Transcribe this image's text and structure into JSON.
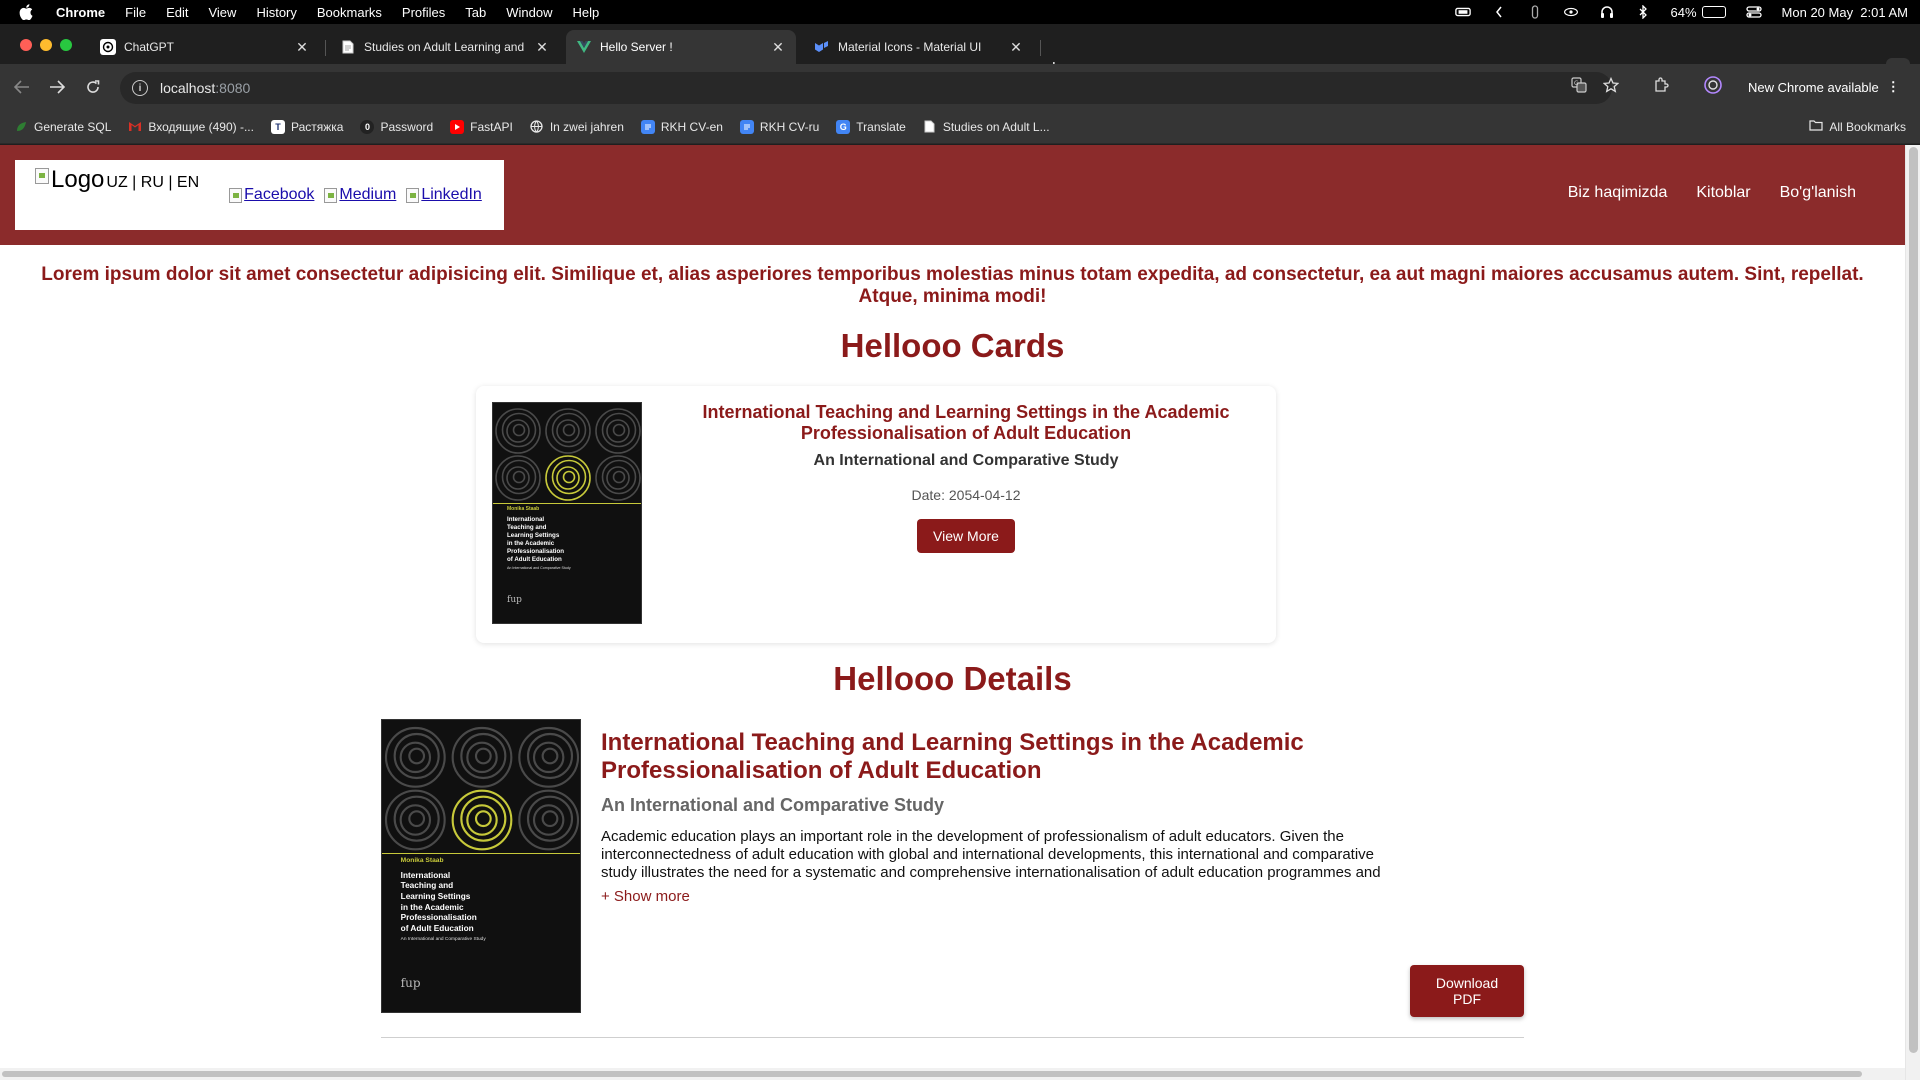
{
  "menubar": {
    "app": "Chrome",
    "items": [
      "File",
      "Edit",
      "View",
      "History",
      "Bookmarks",
      "Profiles",
      "Tab",
      "Window",
      "Help"
    ],
    "battery": "64%",
    "battery_level": 0.64,
    "datetime": "Mon 20 May  2:01 AM"
  },
  "tabs": [
    {
      "title": "ChatGPT",
      "favicon": "chatgpt-icon"
    },
    {
      "title": "Studies on Adult Learning and",
      "favicon": "document-icon"
    },
    {
      "title": "Hello Server !",
      "favicon": "vue-icon",
      "active": true
    },
    {
      "title": "Material Icons - Material UI",
      "favicon": "mui-icon"
    }
  ],
  "toolbar": {
    "url_host": "localhost",
    "url_port": ":8080",
    "new_chrome": "New Chrome available"
  },
  "bookmarks": {
    "items": [
      {
        "label": "Generate SQL",
        "icon": "leaf-icon",
        "color": "#2e7d32"
      },
      {
        "label": "Входящие (490) -...",
        "icon": "gmail-icon",
        "color": "#d93025"
      },
      {
        "label": "Растяжка",
        "icon": "app-icon",
        "color": "#ffffff"
      },
      {
        "label": "Password",
        "icon": "password-icon",
        "color": "#222222"
      },
      {
        "label": "FastAPI",
        "icon": "youtube-icon",
        "color": "#ff0000"
      },
      {
        "label": "In zwei jahren",
        "icon": "globe-icon",
        "color": "#e8e8e8"
      },
      {
        "label": "RKH CV-en",
        "icon": "docs-icon",
        "color": "#4285f4"
      },
      {
        "label": "RKH CV-ru",
        "icon": "docs-icon",
        "color": "#4285f4"
      },
      {
        "label": "Translate",
        "icon": "translate-icon",
        "color": "#4285f4"
      },
      {
        "label": "Studies on Adult L...",
        "icon": "document-icon",
        "color": "#e8e8e8"
      }
    ],
    "all": "All Bookmarks"
  },
  "site": {
    "logo_alt": "Logo",
    "langs": "UZ | RU | EN",
    "socials": [
      "Facebook",
      "Medium",
      "LinkedIn"
    ],
    "nav": [
      "Biz haqimizda",
      "Kitoblar",
      "Bo'g'lanish"
    ],
    "brand_color": "#8b2b2b",
    "lorem": "Lorem ipsum dolor sit amet consectetur adipisicing elit. Similique et, alias asperiores temporibus molestias minus totam expedita, ad consectetur, ea aut magni maiores accusamus autem. Sint, repellat. Atque, minima modi!"
  },
  "cards": {
    "heading": "Hellooo Cards",
    "items": [
      {
        "title": "International Teaching and Learning Settings in the Academic Professionalisation of Adult Education",
        "subtitle": "An International and Comparative Study",
        "date": "Date: 2054-04-12",
        "button": "View More"
      }
    ]
  },
  "details": {
    "heading": "Hellooo Details",
    "title": "International Teaching and Learning Settings in the Academic Professionalisation of Adult Education",
    "subtitle": "An International and Comparative Study",
    "description": "Academic education plays an important role in the development of professionalism of adult educators. Given the interconnectedness of adult education with global and international developments, this international and comparative study illustrates the need for a systematic and comprehensive internationalisation of adult education programmes and the relevance of international teaching and learning settings for the development of",
    "show_more": "+ Show more",
    "download": "Download PDF"
  },
  "book_cover": {
    "author": "Monika Staab",
    "title_lines": [
      "International",
      "Teaching and",
      "Learning Settings",
      "in the Academic",
      "Professionalisation",
      "of Adult Education"
    ],
    "subtitle": "An International and Comparative Study",
    "publisher": "fup"
  }
}
